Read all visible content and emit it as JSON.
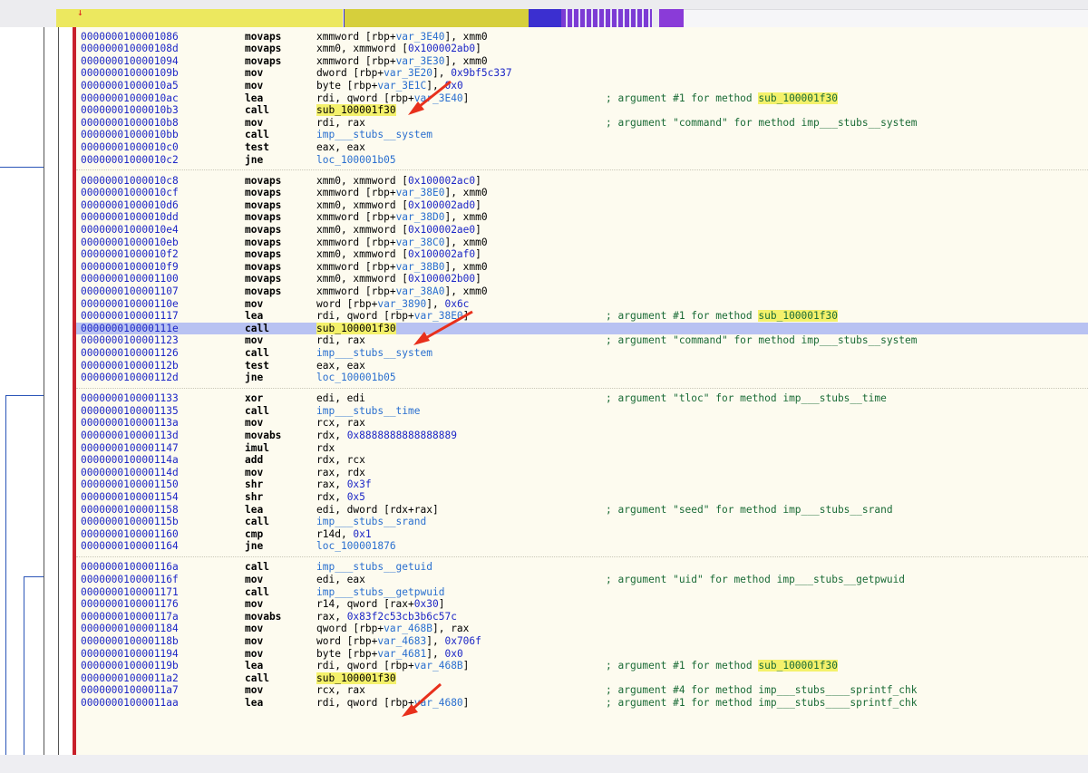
{
  "navigation_bar": {
    "segments": [
      {
        "color": "#ece85f"
      },
      {
        "color": "#d6cf3c"
      },
      {
        "color": "#3b2fd0"
      },
      {
        "color": "#7c3bd4"
      },
      {
        "color": "#8a3bd8"
      }
    ]
  },
  "colors": {
    "listing_bg": "#fdfbef",
    "address": "#1c26c6",
    "label": "#2a6fcf",
    "comment": "#1a6b36",
    "highlight_row": "#b8c2f2",
    "symbol_highlight": "#f4f16b",
    "annotation_arrow": "#e8301c"
  },
  "listing": {
    "blocks": [
      {
        "rows": [
          {
            "addr": "0000000100001086",
            "mn": "movaps",
            "ops": [
              {
                "t": "xmmword [rbp+"
              },
              {
                "t": "var_3E40",
                "c": "lbl"
              },
              {
                "t": "], xmm0"
              }
            ]
          },
          {
            "addr": "000000010000108d",
            "mn": "movaps",
            "ops": [
              {
                "t": "xmm0, xmmword ["
              },
              {
                "t": "0x100002ab0",
                "c": "num"
              },
              {
                "t": "]"
              }
            ]
          },
          {
            "addr": "0000000100001094",
            "mn": "movaps",
            "ops": [
              {
                "t": "xmmword [rbp+"
              },
              {
                "t": "var_3E30",
                "c": "lbl"
              },
              {
                "t": "], xmm0"
              }
            ]
          },
          {
            "addr": "000000010000109b",
            "mn": "mov",
            "ops": [
              {
                "t": "dword [rbp+"
              },
              {
                "t": "var_3E20",
                "c": "lbl"
              },
              {
                "t": "], "
              },
              {
                "t": "0x9bf5c337",
                "c": "num"
              }
            ]
          },
          {
            "addr": "00000001000010a5",
            "mn": "mov",
            "ops": [
              {
                "t": "byte [rbp+"
              },
              {
                "t": "var_3E1C",
                "c": "lbl"
              },
              {
                "t": "], "
              },
              {
                "t": "0x0",
                "c": "num"
              }
            ]
          },
          {
            "addr": "00000001000010ac",
            "mn": "lea",
            "ops": [
              {
                "t": "rdi, qword [rbp+"
              },
              {
                "t": "var_3E40",
                "c": "lbl"
              },
              {
                "t": "]"
              }
            ],
            "cm": [
              {
                "t": "; argument #1 for method "
              },
              {
                "t": "sub_100001f30",
                "c": "hlsym"
              }
            ]
          },
          {
            "addr": "00000001000010b3",
            "mn": "call",
            "ops": [
              {
                "t": "sub_100001f30",
                "c": "hlsym"
              }
            ]
          },
          {
            "addr": "00000001000010b8",
            "mn": "mov",
            "ops": [
              {
                "t": "rdi, rax"
              }
            ],
            "cm": [
              {
                "t": "; argument \"command\" for method imp___stubs__system"
              }
            ]
          },
          {
            "addr": "00000001000010bb",
            "mn": "call",
            "ops": [
              {
                "t": "imp___stubs__system",
                "c": "lbl"
              }
            ]
          },
          {
            "addr": "00000001000010c0",
            "mn": "test",
            "ops": [
              {
                "t": "eax, eax"
              }
            ]
          },
          {
            "addr": "00000001000010c2",
            "mn": "jne",
            "ops": [
              {
                "t": "loc_100001b05",
                "c": "lbl"
              }
            ]
          }
        ]
      },
      {
        "rows": [
          {
            "addr": "00000001000010c8",
            "mn": "movaps",
            "ops": [
              {
                "t": "xmm0, xmmword ["
              },
              {
                "t": "0x100002ac0",
                "c": "num"
              },
              {
                "t": "]"
              }
            ]
          },
          {
            "addr": "00000001000010cf",
            "mn": "movaps",
            "ops": [
              {
                "t": "xmmword [rbp+"
              },
              {
                "t": "var_38E0",
                "c": "lbl"
              },
              {
                "t": "], xmm0"
              }
            ]
          },
          {
            "addr": "00000001000010d6",
            "mn": "movaps",
            "ops": [
              {
                "t": "xmm0, xmmword ["
              },
              {
                "t": "0x100002ad0",
                "c": "num"
              },
              {
                "t": "]"
              }
            ]
          },
          {
            "addr": "00000001000010dd",
            "mn": "movaps",
            "ops": [
              {
                "t": "xmmword [rbp+"
              },
              {
                "t": "var_38D0",
                "c": "lbl"
              },
              {
                "t": "], xmm0"
              }
            ]
          },
          {
            "addr": "00000001000010e4",
            "mn": "movaps",
            "ops": [
              {
                "t": "xmm0, xmmword ["
              },
              {
                "t": "0x100002ae0",
                "c": "num"
              },
              {
                "t": "]"
              }
            ]
          },
          {
            "addr": "00000001000010eb",
            "mn": "movaps",
            "ops": [
              {
                "t": "xmmword [rbp+"
              },
              {
                "t": "var_38C0",
                "c": "lbl"
              },
              {
                "t": "], xmm0"
              }
            ]
          },
          {
            "addr": "00000001000010f2",
            "mn": "movaps",
            "ops": [
              {
                "t": "xmm0, xmmword ["
              },
              {
                "t": "0x100002af0",
                "c": "num"
              },
              {
                "t": "]"
              }
            ]
          },
          {
            "addr": "00000001000010f9",
            "mn": "movaps",
            "ops": [
              {
                "t": "xmmword [rbp+"
              },
              {
                "t": "var_38B0",
                "c": "lbl"
              },
              {
                "t": "], xmm0"
              }
            ]
          },
          {
            "addr": "0000000100001100",
            "mn": "movaps",
            "ops": [
              {
                "t": "xmm0, xmmword ["
              },
              {
                "t": "0x100002b00",
                "c": "num"
              },
              {
                "t": "]"
              }
            ]
          },
          {
            "addr": "0000000100001107",
            "mn": "movaps",
            "ops": [
              {
                "t": "xmmword [rbp+"
              },
              {
                "t": "var_38A0",
                "c": "lbl"
              },
              {
                "t": "], xmm0"
              }
            ]
          },
          {
            "addr": "000000010000110e",
            "mn": "mov",
            "ops": [
              {
                "t": "word [rbp+"
              },
              {
                "t": "var_3890",
                "c": "lbl"
              },
              {
                "t": "], "
              },
              {
                "t": "0x6c",
                "c": "num"
              }
            ]
          },
          {
            "addr": "0000000100001117",
            "mn": "lea",
            "ops": [
              {
                "t": "rdi, qword [rbp+"
              },
              {
                "t": "var_38E0",
                "c": "lbl"
              },
              {
                "t": "]"
              }
            ],
            "cm": [
              {
                "t": "; argument #1 for method "
              },
              {
                "t": "sub_100001f30",
                "c": "hlsym"
              }
            ]
          },
          {
            "addr": "000000010000111e",
            "mn": "call",
            "ops": [
              {
                "t": "sub_100001f30",
                "c": "hlsym"
              }
            ],
            "selected": true
          },
          {
            "addr": "0000000100001123",
            "mn": "mov",
            "ops": [
              {
                "t": "rdi, rax"
              }
            ],
            "cm": [
              {
                "t": "; argument \"command\" for method imp___stubs__system"
              }
            ]
          },
          {
            "addr": "0000000100001126",
            "mn": "call",
            "ops": [
              {
                "t": "imp___stubs__system",
                "c": "lbl"
              }
            ]
          },
          {
            "addr": "000000010000112b",
            "mn": "test",
            "ops": [
              {
                "t": "eax, eax"
              }
            ]
          },
          {
            "addr": "000000010000112d",
            "mn": "jne",
            "ops": [
              {
                "t": "loc_100001b05",
                "c": "lbl"
              }
            ]
          }
        ]
      },
      {
        "rows": [
          {
            "addr": "0000000100001133",
            "mn": "xor",
            "ops": [
              {
                "t": "edi, edi"
              }
            ],
            "cm": [
              {
                "t": "; argument \"tloc\" for method imp___stubs__time"
              }
            ]
          },
          {
            "addr": "0000000100001135",
            "mn": "call",
            "ops": [
              {
                "t": "imp___stubs__time",
                "c": "lbl"
              }
            ]
          },
          {
            "addr": "000000010000113a",
            "mn": "mov",
            "ops": [
              {
                "t": "rcx, rax"
              }
            ]
          },
          {
            "addr": "000000010000113d",
            "mn": "movabs",
            "ops": [
              {
                "t": "rdx, "
              },
              {
                "t": "0x8888888888888889",
                "c": "num"
              }
            ]
          },
          {
            "addr": "0000000100001147",
            "mn": "imul",
            "ops": [
              {
                "t": "rdx"
              }
            ]
          },
          {
            "addr": "000000010000114a",
            "mn": "add",
            "ops": [
              {
                "t": "rdx, rcx"
              }
            ]
          },
          {
            "addr": "000000010000114d",
            "mn": "mov",
            "ops": [
              {
                "t": "rax, rdx"
              }
            ]
          },
          {
            "addr": "0000000100001150",
            "mn": "shr",
            "ops": [
              {
                "t": "rax, "
              },
              {
                "t": "0x3f",
                "c": "num"
              }
            ]
          },
          {
            "addr": "0000000100001154",
            "mn": "shr",
            "ops": [
              {
                "t": "rdx, "
              },
              {
                "t": "0x5",
                "c": "num"
              }
            ]
          },
          {
            "addr": "0000000100001158",
            "mn": "lea",
            "ops": [
              {
                "t": "edi, dword [rdx+rax]"
              }
            ],
            "cm": [
              {
                "t": "; argument \"seed\" for method imp___stubs__srand"
              }
            ]
          },
          {
            "addr": "000000010000115b",
            "mn": "call",
            "ops": [
              {
                "t": "imp___stubs__srand",
                "c": "lbl"
              }
            ]
          },
          {
            "addr": "0000000100001160",
            "mn": "cmp",
            "ops": [
              {
                "t": "r14d, "
              },
              {
                "t": "0x1",
                "c": "num"
              }
            ]
          },
          {
            "addr": "0000000100001164",
            "mn": "jne",
            "ops": [
              {
                "t": "loc_100001876",
                "c": "lbl"
              }
            ]
          }
        ]
      },
      {
        "rows": [
          {
            "addr": "000000010000116a",
            "mn": "call",
            "ops": [
              {
                "t": "imp___stubs__getuid",
                "c": "lbl"
              }
            ]
          },
          {
            "addr": "000000010000116f",
            "mn": "mov",
            "ops": [
              {
                "t": "edi, eax"
              }
            ],
            "cm": [
              {
                "t": "; argument \"uid\" for method imp___stubs__getpwuid"
              }
            ]
          },
          {
            "addr": "0000000100001171",
            "mn": "call",
            "ops": [
              {
                "t": "imp___stubs__getpwuid",
                "c": "lbl"
              }
            ]
          },
          {
            "addr": "0000000100001176",
            "mn": "mov",
            "ops": [
              {
                "t": "r14, qword [rax+"
              },
              {
                "t": "0x30",
                "c": "num"
              },
              {
                "t": "]"
              }
            ]
          },
          {
            "addr": "000000010000117a",
            "mn": "movabs",
            "ops": [
              {
                "t": "rax, "
              },
              {
                "t": "0x83f2c53cb3b6c57c",
                "c": "num"
              }
            ]
          },
          {
            "addr": "0000000100001184",
            "mn": "mov",
            "ops": [
              {
                "t": "qword [rbp+"
              },
              {
                "t": "var_468B",
                "c": "lbl"
              },
              {
                "t": "], rax"
              }
            ]
          },
          {
            "addr": "000000010000118b",
            "mn": "mov",
            "ops": [
              {
                "t": "word [rbp+"
              },
              {
                "t": "var_4683",
                "c": "lbl"
              },
              {
                "t": "], "
              },
              {
                "t": "0x706f",
                "c": "num"
              }
            ]
          },
          {
            "addr": "0000000100001194",
            "mn": "mov",
            "ops": [
              {
                "t": "byte [rbp+"
              },
              {
                "t": "var_4681",
                "c": "lbl"
              },
              {
                "t": "], "
              },
              {
                "t": "0x0",
                "c": "num"
              }
            ]
          },
          {
            "addr": "000000010000119b",
            "mn": "lea",
            "ops": [
              {
                "t": "rdi, qword [rbp+"
              },
              {
                "t": "var_468B",
                "c": "lbl"
              },
              {
                "t": "]"
              }
            ],
            "cm": [
              {
                "t": "; argument #1 for method "
              },
              {
                "t": "sub_100001f30",
                "c": "hlsym"
              }
            ]
          },
          {
            "addr": "00000001000011a2",
            "mn": "call",
            "ops": [
              {
                "t": "sub_100001f30",
                "c": "hlsym"
              }
            ]
          },
          {
            "addr": "00000001000011a7",
            "mn": "mov",
            "ops": [
              {
                "t": "rcx, rax"
              }
            ],
            "cm": [
              {
                "t": "; argument #4 for method imp___stubs____sprintf_chk"
              }
            ]
          },
          {
            "addr": "00000001000011aa",
            "mn": "lea",
            "ops": [
              {
                "t": "rdi, qword [rbp+"
              },
              {
                "t": "var_4680",
                "c": "lbl"
              },
              {
                "t": "]"
              }
            ],
            "cm": [
              {
                "t": "; argument #1 for method imp___stubs____sprintf_chk"
              }
            ]
          }
        ]
      }
    ]
  },
  "annotations": {
    "arrows": [
      {
        "target": "00000001000010b3",
        "color": "#e8301c"
      },
      {
        "target": "000000010000111e",
        "color": "#e8301c"
      },
      {
        "target": "00000001000011a2",
        "color": "#e8301c"
      }
    ]
  }
}
